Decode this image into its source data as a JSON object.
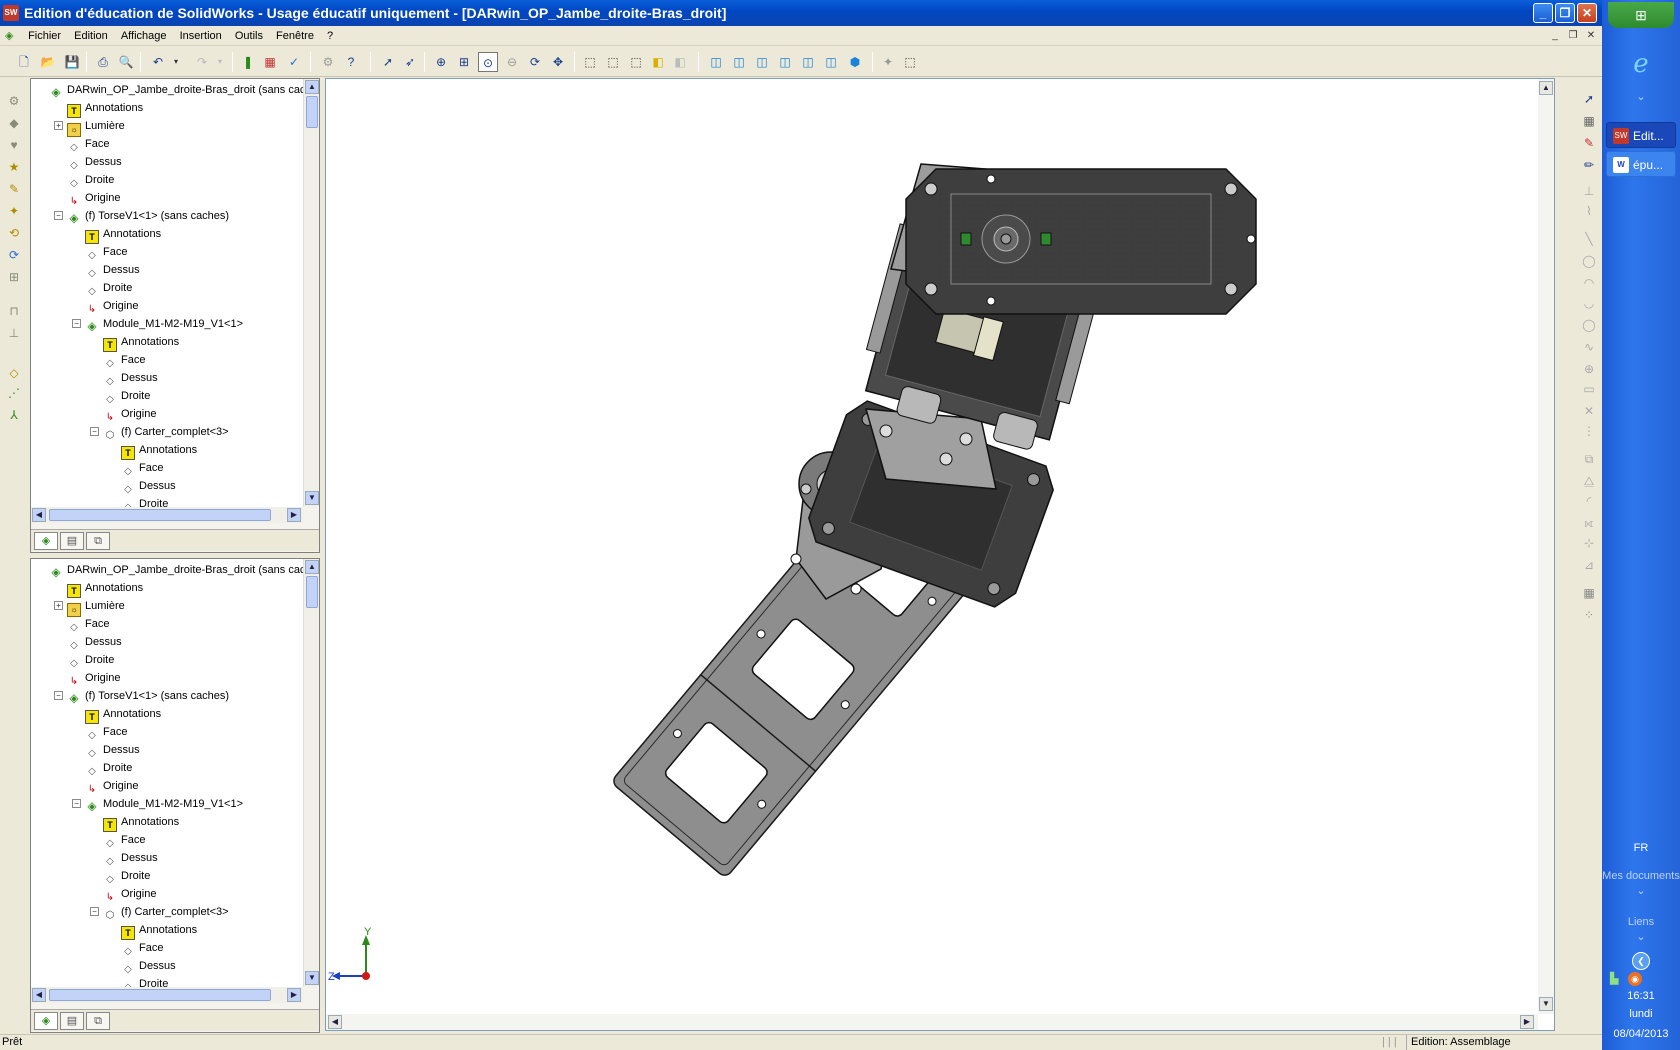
{
  "window": {
    "title": "Edition d'éducation de SolidWorks - Usage éducatif uniquement - [DARwin_OP_Jambe_droite-Bras_droit]",
    "icon": "sw-app-icon",
    "app_icon_text": "SW"
  },
  "menu": {
    "items": [
      "Fichier",
      "Edition",
      "Affichage",
      "Insertion",
      "Outils",
      "Fenêtre",
      "?"
    ]
  },
  "feature_tree": {
    "rows": [
      {
        "label": "DARwin_OP_Jambe_droite-Bras_droit  (sans caches",
        "icon": "assembly-icon",
        "level": 0,
        "expander": ""
      },
      {
        "label": "Annotations",
        "icon": "annotations-icon",
        "level": 1,
        "expander": ""
      },
      {
        "label": "Lumière",
        "icon": "lights-icon",
        "level": 1,
        "expander": "+"
      },
      {
        "label": "Face",
        "icon": "plane-icon",
        "level": 1,
        "expander": ""
      },
      {
        "label": "Dessus",
        "icon": "plane-icon",
        "level": 1,
        "expander": ""
      },
      {
        "label": "Droite",
        "icon": "plane-icon",
        "level": 1,
        "expander": ""
      },
      {
        "label": "Origine",
        "icon": "origin-icon",
        "level": 1,
        "expander": ""
      },
      {
        "label": "(f) TorseV1<1> (sans caches)",
        "icon": "subassembly-icon",
        "level": 1,
        "expander": "−"
      },
      {
        "label": "Annotations",
        "icon": "annotations-icon",
        "level": 2,
        "expander": ""
      },
      {
        "label": "Face",
        "icon": "plane-icon",
        "level": 2,
        "expander": ""
      },
      {
        "label": "Dessus",
        "icon": "plane-icon",
        "level": 2,
        "expander": ""
      },
      {
        "label": "Droite",
        "icon": "plane-icon",
        "level": 2,
        "expander": ""
      },
      {
        "label": "Origine",
        "icon": "origin-icon",
        "level": 2,
        "expander": ""
      },
      {
        "label": "Module_M1-M2-M19_V1<1>",
        "icon": "subassembly-icon",
        "level": 2,
        "expander": "−"
      },
      {
        "label": "Annotations",
        "icon": "annotations-icon",
        "level": 3,
        "expander": ""
      },
      {
        "label": "Face",
        "icon": "plane-icon",
        "level": 3,
        "expander": ""
      },
      {
        "label": "Dessus",
        "icon": "plane-icon",
        "level": 3,
        "expander": ""
      },
      {
        "label": "Droite",
        "icon": "plane-icon",
        "level": 3,
        "expander": ""
      },
      {
        "label": "Origine",
        "icon": "origin-icon",
        "level": 3,
        "expander": ""
      },
      {
        "label": "(f) Carter_complet<3>",
        "icon": "part-icon",
        "level": 3,
        "expander": "−"
      },
      {
        "label": "Annotations",
        "icon": "annotations-icon",
        "level": 4,
        "expander": ""
      },
      {
        "label": "Face",
        "icon": "plane-icon",
        "level": 4,
        "expander": ""
      },
      {
        "label": "Dessus",
        "icon": "plane-icon",
        "level": 4,
        "expander": ""
      },
      {
        "label": "Droite",
        "icon": "plane-icon",
        "level": 4,
        "expander": ""
      }
    ]
  },
  "pane_tabs": [
    "featuremanager-tab-icon",
    "propertymanager-tab-icon",
    "configurationmanager-tab-icon"
  ],
  "viewport": {
    "triad": {
      "x_label": "Y",
      "z_label": "Z"
    }
  },
  "status": {
    "left": "Prêt",
    "right": "Edition: Assemblage"
  },
  "taskbar": {
    "tasks": [
      {
        "label": "Edit...",
        "icon": "solidworks-icon",
        "icon_text": "SW"
      },
      {
        "label": "épu...",
        "icon": "word-icon",
        "icon_text": "W"
      }
    ],
    "language": "FR",
    "toolbars": [
      "Mes documents",
      "Liens"
    ],
    "time": "16:31",
    "day": "lundi",
    "date": "08/04/2013"
  },
  "colors": {
    "title_bar": "#0a5fd8",
    "part_dark": "#3f3f3f",
    "part_mid": "#8a8a8a",
    "part_light": "#b8b8b8",
    "taskbar": "#2463d8"
  }
}
